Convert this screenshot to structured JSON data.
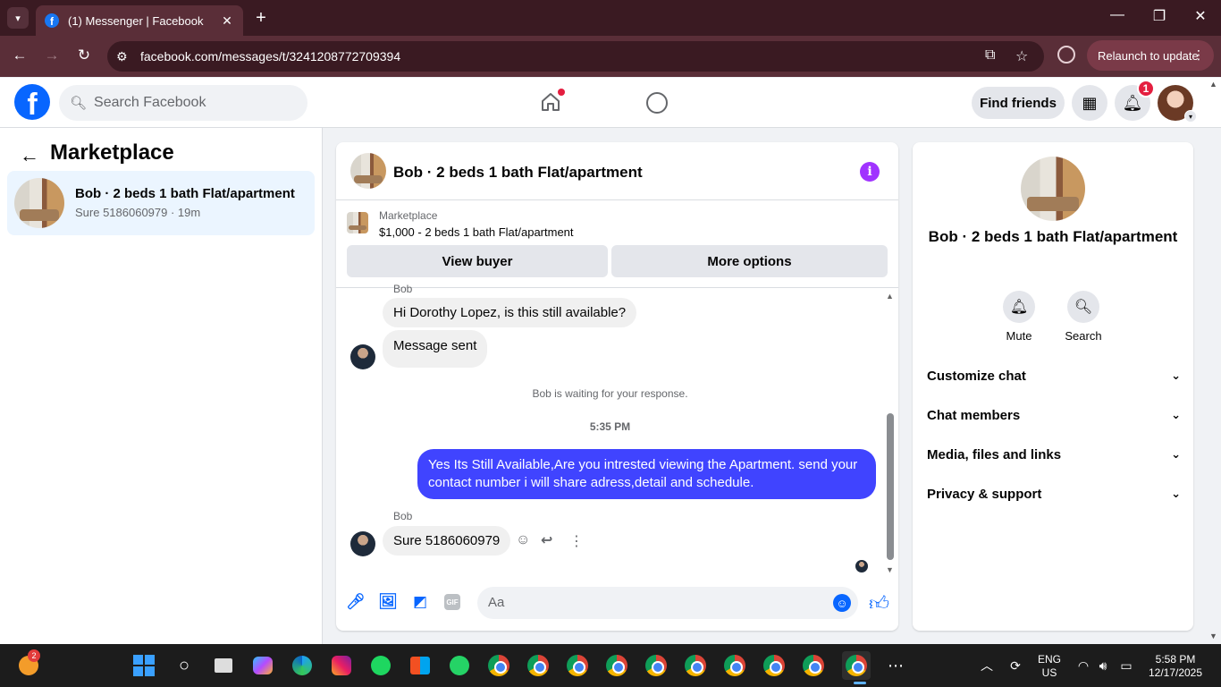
{
  "browser": {
    "tab_title": "(1) Messenger | Facebook",
    "url": "facebook.com/messages/t/3241208772709394",
    "relaunch_label": "Relaunch to update"
  },
  "fb": {
    "search_placeholder": "Search Facebook",
    "find_friends": "Find friends",
    "notification_count": "1"
  },
  "sidebar": {
    "title": "Marketplace",
    "conversation": {
      "title": "Bob · 2 beds 1 bath Flat/apartment",
      "preview": "Sure 5186060979 · 19m"
    }
  },
  "chat": {
    "title": "Bob · 2 beds 1 bath Flat/apartment",
    "marketplace_label": "Marketplace",
    "listing": "$1,000 - 2 beds 1 bath Flat/apartment",
    "view_buyer": "View buyer",
    "more_options": "More options",
    "messages": {
      "sender_top": "Bob",
      "m1": "Hi Dorothy Lopez, is this still available?",
      "m2": "Message sent",
      "system": "Bob is waiting for your response.",
      "time": "5:35 PM",
      "m3": "Yes Its Still Available,Are you intrested viewing the Apartment. send your contact number i will share adress,detail and schedule.",
      "sender_bottom": "Bob",
      "m4": "Sure 5186060979"
    },
    "composer_placeholder": "Aa",
    "gif_label": "GIF"
  },
  "info_panel": {
    "name": "Bob · 2 beds 1 bath Flat/apartment",
    "mute": "Mute",
    "search": "Search",
    "rows": [
      "Customize chat",
      "Chat members",
      "Media, files and links",
      "Privacy & support"
    ]
  },
  "taskbar": {
    "badge": "2",
    "lang1": "ENG",
    "lang2": "US",
    "time": "5:58 PM",
    "date": "12/17/2025"
  },
  "colors": {
    "facebook_blue": "#0866ff",
    "outgoing_bubble": "#4044ff",
    "notification_red": "#e41e3f",
    "browser_frame": "#3a1a22"
  }
}
